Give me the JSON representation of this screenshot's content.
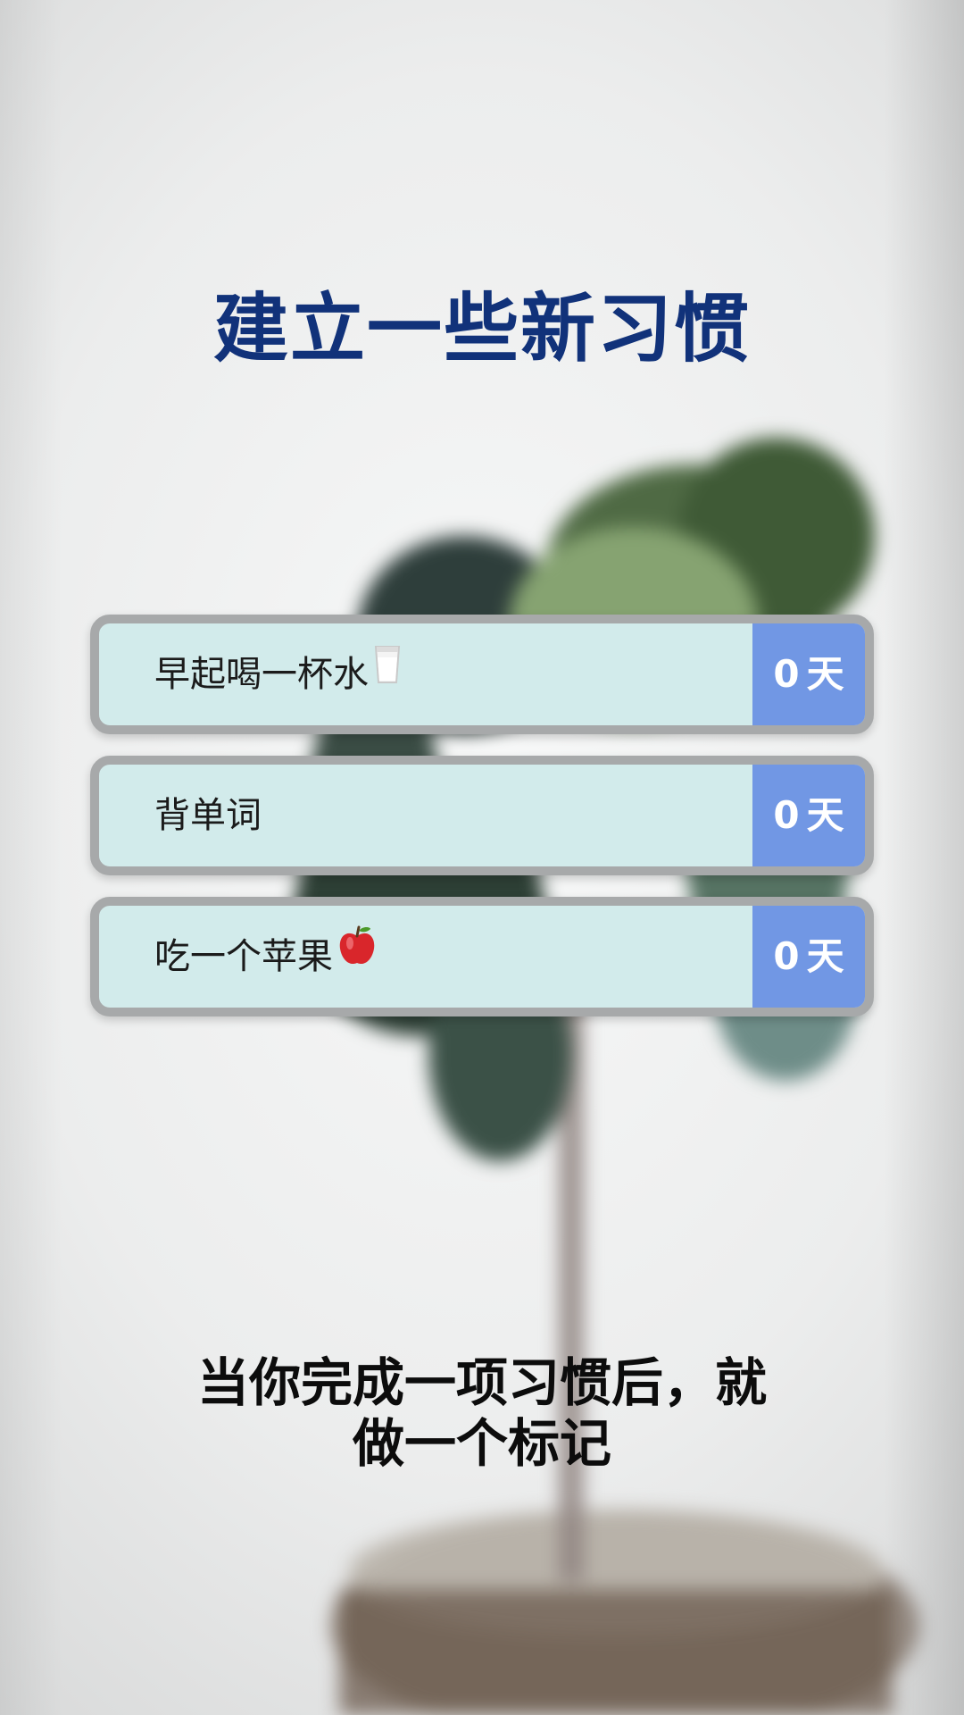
{
  "title": "建立一些新习惯",
  "habits": [
    {
      "label": "早起喝一杯水",
      "icon": "milk-glass-icon",
      "count": "0",
      "unit": "天"
    },
    {
      "label": "背单词",
      "icon": "",
      "count": "0",
      "unit": "天"
    },
    {
      "label": "吃一个苹果",
      "icon": "apple-icon",
      "count": "0",
      "unit": "天"
    }
  ],
  "subtitle": {
    "line1": "当你完成一项习惯后，就",
    "line2": "做一个标记"
  },
  "colors": {
    "title": "#11327a",
    "habit_bg": "#d2ebeb",
    "habit_border": "#a7a9aa",
    "count_bg": "#7197e4"
  }
}
